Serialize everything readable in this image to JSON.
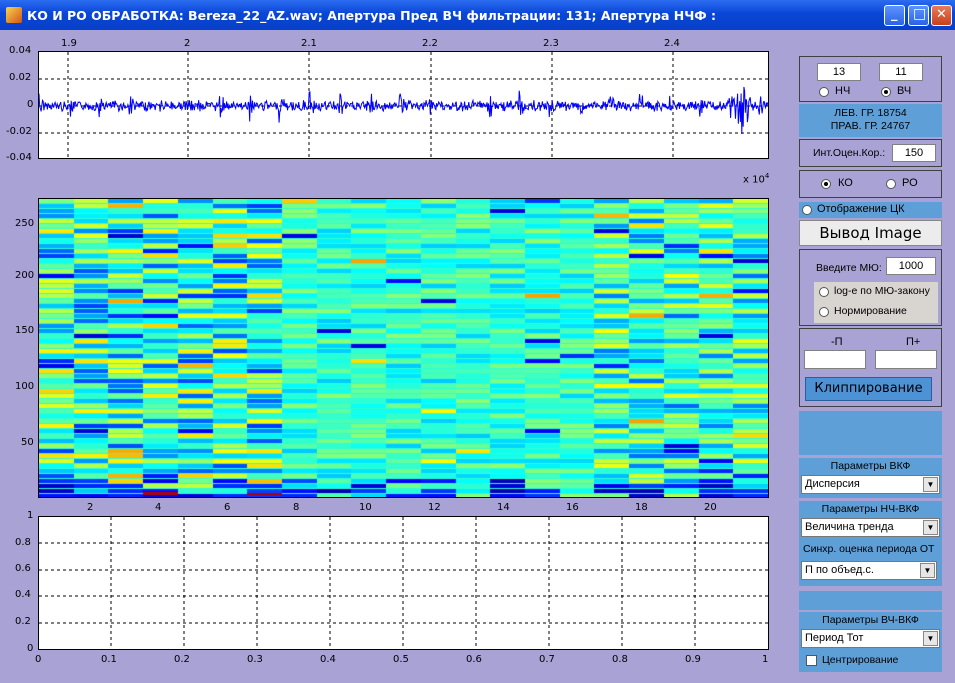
{
  "window": {
    "title": "КО И РО ОБРАБОТКА: Bereza_22_AZ.wav;  Апертура Пред ВЧ фильтрации: 131;  Апертура НЧФ :",
    "minimize": "_",
    "maximize": "□",
    "close": "✕"
  },
  "waveform": {
    "top_ticks": [
      "1.9",
      "2",
      "2.1",
      "2.2",
      "2.3",
      "2.4"
    ],
    "y_ticks": [
      "0.04",
      "0.02",
      "0",
      "-0.02",
      "-0.04"
    ],
    "exponent": "x 10",
    "exponent_power": "4",
    "line_color": "#0000ff"
  },
  "heatmap": {
    "y_ticks": [
      "250",
      "200",
      "150",
      "100",
      "50"
    ],
    "x_ticks": [
      "2",
      "4",
      "6",
      "8",
      "10",
      "12",
      "14",
      "16",
      "18",
      "20"
    ]
  },
  "lower_plot": {
    "y_ticks": [
      "1",
      "0.8",
      "0.6",
      "0.4",
      "0.2",
      "0"
    ],
    "x_ticks": [
      "0",
      "0.1",
      "0.2",
      "0.3",
      "0.4",
      "0.5",
      "0.6",
      "0.7",
      "0.8",
      "0.9",
      "1"
    ]
  },
  "controls": {
    "filter_left": "13",
    "filter_right": "11",
    "radio_nch": "НЧ",
    "radio_vch": "ВЧ",
    "lev_gr": "ЛЕВ. ГР.  18754",
    "prav_gr": "ПРАВ. ГР. 24767",
    "int_label": "Инт.Оцен.Кор.:",
    "int_value": "150",
    "radio_ko": "КО",
    "radio_ro": "РО",
    "display_ck": "Отображение ЦК",
    "output_image": "Вывод Image",
    "mu_label": "Введите МЮ:",
    "mu_value": "1000",
    "log_mu": "log-е по МЮ-закону",
    "normalize": "Нормирование",
    "minus_p": "-П",
    "plus_p": "П+",
    "clip_button": "Клиппирование",
    "vkf_header": "Параметры ВКФ",
    "vkf_select": "Дисперсия",
    "nch_vkf_header": "Параметры НЧ-ВКФ",
    "nch_vkf_select": "Величина тренда",
    "sync_label": "Синхр. оценка периода ОТ",
    "sync_select": "П по объед.с.",
    "vch_vkf_header": "Параметры ВЧ-ВКФ",
    "vch_vkf_select": "Период Тот",
    "centering": "Центрирование"
  }
}
